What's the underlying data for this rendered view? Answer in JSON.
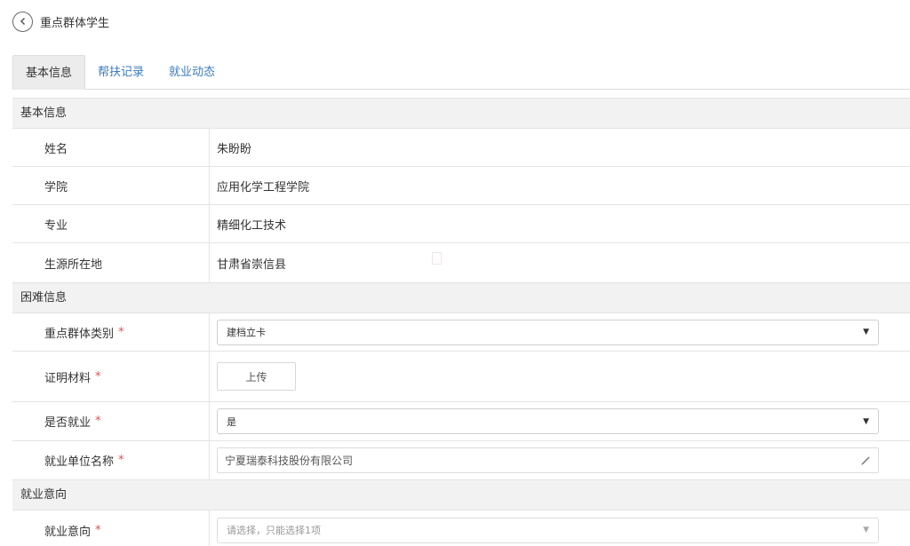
{
  "header": {
    "title": "重点群体学生"
  },
  "tabs": [
    "基本信息",
    "帮扶记录",
    "就业动态"
  ],
  "sections": {
    "basic": "基本信息",
    "difficulty": "困难信息",
    "intention": "就业意向"
  },
  "basic_info": {
    "name_label": "姓名",
    "name_value": "朱盼盼",
    "college_label": "学院",
    "college_value": "应用化学工程学院",
    "major_label": "专业",
    "major_value": "精细化工技术",
    "origin_label": "生源所在地",
    "origin_value": "甘肃省崇信县"
  },
  "difficulty_info": {
    "category_label": "重点群体类别",
    "category_value": "建档立卡",
    "proof_label": "证明材料",
    "upload_label": "上传",
    "employed_label": "是否就业",
    "employed_value": "是",
    "employer_label": "就业单位名称",
    "employer_value": "宁夏瑞泰科技股份有限公司"
  },
  "intention_info": {
    "intention_label": "就业意向",
    "intention_placeholder": "请选择，只能选择1项"
  },
  "required_mark": "*",
  "colors": {
    "link": "#3b7bbf",
    "required": "#d9534f",
    "section_bg": "#f2f2f2"
  }
}
